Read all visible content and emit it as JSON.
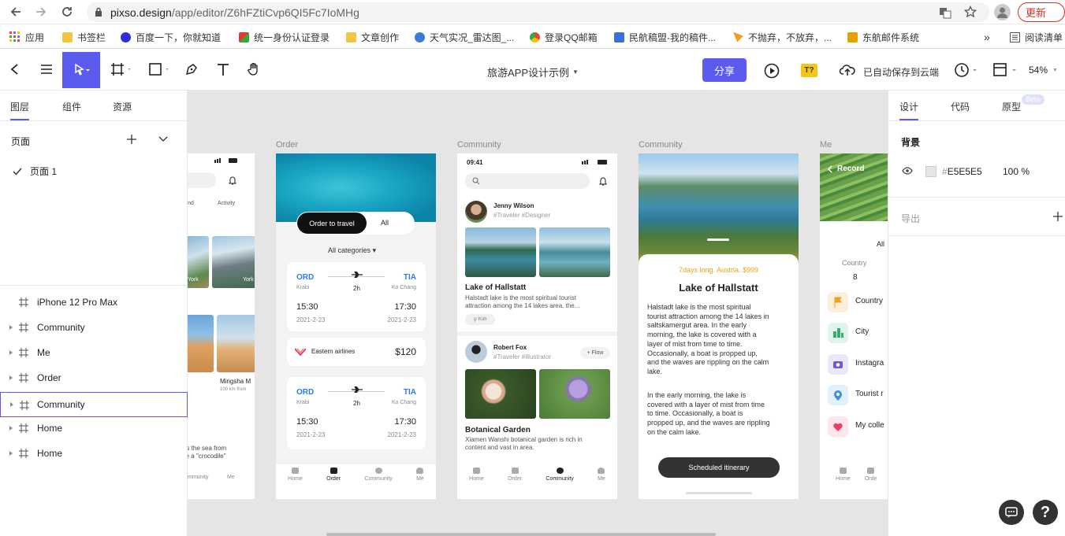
{
  "browser": {
    "url_domain": "pixso.design",
    "url_path": "/app/editor/Z6hFZtiCvp6QI5Fc7IoMHg",
    "update_label": "更新",
    "bookmarks": [
      "应用",
      "书签栏",
      "百度一下，你就知道",
      "统一身份认证登录",
      "文章创作",
      "天气实况_雷达图_...",
      "登录QQ邮箱",
      "民航稿盟-我的稿件...",
      "不抛弃，不放弃，...",
      "东航邮件系统"
    ],
    "more": "»",
    "reading_list": "阅读清单"
  },
  "toolbar": {
    "file_title": "旅游APP设计示例",
    "share_label": "分享",
    "autosave": "已自动保存到云端",
    "zoom": "54%",
    "t_badge": "T?"
  },
  "left_panel": {
    "tabs": [
      "图层",
      "组件",
      "资源"
    ],
    "pages_title": "页面",
    "page1": "页面 1",
    "layers": [
      "iPhone 12 Pro Max",
      "Community",
      "Me",
      "Order",
      "Community",
      "Home",
      "Home"
    ]
  },
  "right_panel": {
    "tabs": [
      "设计",
      "代码",
      "原型"
    ],
    "beta": "Beta",
    "bg_title": "背景",
    "bg_hash": "#",
    "bg_color": "E5E5E5",
    "bg_opacity": "100 %",
    "export": "导出"
  },
  "canvas": {
    "labels": [
      "Order",
      "Community",
      "Community",
      "Me"
    ],
    "home": {
      "round": "round",
      "activity": "Activity",
      "york1": "York",
      "york2": "York",
      "mingsha": "Mingsha M",
      "km": "100 km from",
      "sea": "oss the sea from",
      "croc": " like a \"crocodile\"",
      "nav": [
        "mmunity",
        "Me"
      ]
    },
    "order": {
      "btn_travel": "Order to travel",
      "btn_all": "All",
      "categories": "All categories ▾",
      "t1": {
        "from": "ORD",
        "to": "TIA",
        "from_city": "Krabi",
        "dur": "2h",
        "to_city": "Ko Chang",
        "dep": "15:30",
        "arr": "17:30",
        "d1": "2021-2-23",
        "d2": "2021-2-23"
      },
      "airline": "Eastern airlines",
      "price": "$120",
      "t2": {
        "from": "ORD",
        "to": "TIA",
        "from_city": "Krabi",
        "dur": "2h",
        "to_city": "Ko Chang",
        "dep": "15:30",
        "arr": "17:30",
        "d1": "2021-2-23",
        "d2": "2021-2-23"
      },
      "nav": [
        "Home",
        "Order",
        "Community",
        "Me"
      ]
    },
    "community1": {
      "time": "09:41",
      "user1": "Jenny Wilson",
      "tags1": "#Traveler  #Designer",
      "post1_title": "Lake of Hallstatt",
      "post1_body1": "Halstadt lake is the most spiritual tourist",
      "post1_body2": "attraction among the 14 lakes  area. the...",
      "loc": "Koh",
      "user2": "Robert Fox",
      "tags2": "#Traveler  #Illustrator",
      "follow": "+ Flow",
      "post2_title": "Botanical Garden",
      "post2_body1": "Xiamen Wanshi botanical garden is rich in",
      "post2_body2": "content and vast in area.",
      "nav": [
        "Home",
        "Order",
        "Community",
        "Me"
      ]
    },
    "community2": {
      "subtitle": "7days long. Austria. $999",
      "title": "Lake of Hallstatt",
      "p1": [
        "Halstadt lake is the most spiritual",
        "tourist attraction among the 14 lakes in",
        "saltskamergut area. In the early",
        "morning, the lake is covered with a",
        "layer of mist from time to time.",
        "Occasionally, a boat is propped up,",
        "and the waves are rippling on the calm",
        "lake."
      ],
      "p2": [
        "In the early morning, the lake is",
        "covered with a layer of mist from time",
        "to time. Occasionally, a boat is",
        "propped up, and the waves are rippling",
        "on the calm lake."
      ],
      "button": "Scheduled itinerary"
    },
    "me": {
      "record": "Record",
      "all": "All",
      "country_label": "Country",
      "country_count": "8",
      "items": [
        "Country",
        "City",
        "Instagra",
        "Tourist r",
        "My colle"
      ],
      "nav": [
        "Home",
        "Orde"
      ]
    }
  },
  "colors": {
    "accent": "#5b5bf0",
    "canvas_bg": "#e5e5e5",
    "orange": "#f0a020",
    "blue": "#2b7de9"
  }
}
